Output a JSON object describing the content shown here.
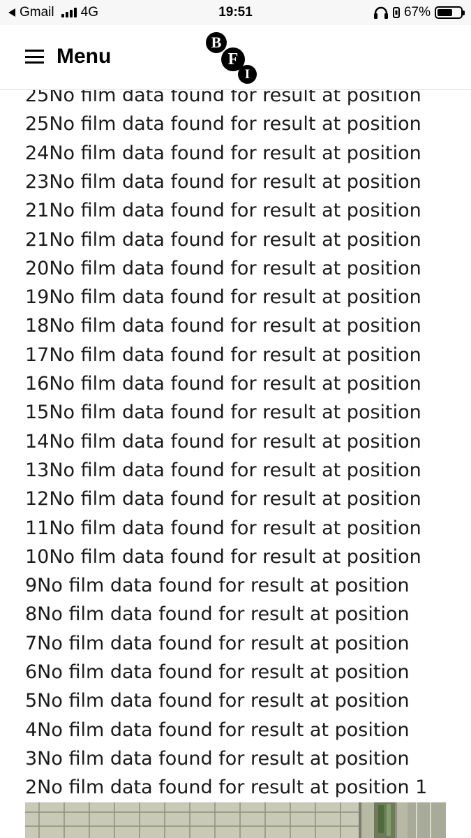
{
  "status_bar": {
    "back_app": "Gmail",
    "network": "4G",
    "time": "19:51",
    "battery": "67%",
    "battery_level": 0.67
  },
  "header": {
    "menu_label": "Menu",
    "logo_letters": [
      "B",
      "F",
      "I"
    ]
  },
  "results": [
    "25No film data found for result at position",
    "25No film data found for result at position",
    "24No film data found for result at position",
    "23No film data found for result at position",
    "21No film data found for result at position",
    "21No film data found for result at position",
    "20No film data found for result at position",
    "19No film data found for result at position",
    "18No film data found for result at position",
    "17No film data found for result at position",
    "16No film data found for result at position",
    "15No film data found for result at position",
    "14No film data found for result at position",
    "13No film data found for result at position",
    "12No film data found for result at position",
    "11No film data found for result at position",
    "10No film data found for result at position",
    "9No film data found for result at position",
    "8No film data found for result at position",
    "7No film data found for result at position",
    "6No film data found for result at position",
    "5No film data found for result at position",
    "4No film data found for result at position",
    "3No film data found for result at position",
    "2No film data found for result at position 1"
  ]
}
